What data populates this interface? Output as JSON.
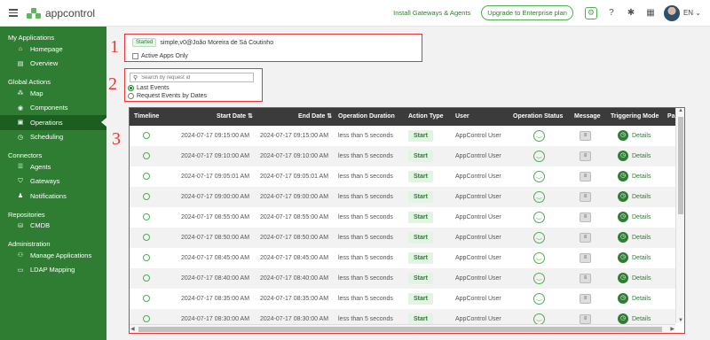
{
  "topbar": {
    "app_name": "appcontrol",
    "install_link": "Install Gateways & Agents",
    "upgrade_button": "Upgrade to Enterprise plan",
    "language": "EN"
  },
  "sidebar": {
    "sections": [
      {
        "title": "My Applications",
        "items": [
          {
            "label": "Homepage",
            "icon": "home-icon"
          },
          {
            "label": "Overview",
            "icon": "overview-icon"
          }
        ]
      },
      {
        "title": "Global Actions",
        "items": [
          {
            "label": "Map",
            "icon": "map-icon"
          },
          {
            "label": "Components",
            "icon": "components-icon"
          },
          {
            "label": "Operations",
            "icon": "operations-icon"
          },
          {
            "label": "Scheduling",
            "icon": "scheduling-icon"
          }
        ]
      },
      {
        "title": "Connectors",
        "items": [
          {
            "label": "Agents",
            "icon": "agents-icon"
          },
          {
            "label": "Gateways",
            "icon": "gateways-icon"
          },
          {
            "label": "Notifications",
            "icon": "notifications-icon"
          }
        ]
      },
      {
        "title": "Repositories",
        "items": [
          {
            "label": "CMDB",
            "icon": "cmdb-icon"
          }
        ]
      },
      {
        "title": "Administration",
        "items": [
          {
            "label": "Manage Applications",
            "icon": "manage-applications-icon"
          },
          {
            "label": "LDAP Mapping",
            "icon": "ldap-icon"
          }
        ]
      }
    ],
    "active": "Operations"
  },
  "annotations": [
    "1",
    "2",
    "3"
  ],
  "app_selector": {
    "status_badge": "Started",
    "app_name": "simple,v0@João Moreira de Sá Coutinho",
    "active_only_label": "Active Apps Only"
  },
  "filters": {
    "search_placeholder": "Search by request id",
    "radio_last": "Last Events",
    "radio_by_dates": "Request Events by Dates"
  },
  "table": {
    "headers": [
      "Timeline",
      "Start Date",
      "End Date",
      "Operation Duration",
      "Action Type",
      "User",
      "Operation Status",
      "Message",
      "Triggering Mode",
      "Pa"
    ],
    "rows": [
      {
        "start": "2024-07-17 09:15:00 AM",
        "end": "2024-07-17 09:15:00 AM",
        "duration": "less than 5 seconds",
        "action": "Start",
        "user": "AppControl User",
        "details": "Details"
      },
      {
        "start": "2024-07-17 09:10:00 AM",
        "end": "2024-07-17 09:10:00 AM",
        "duration": "less than 5 seconds",
        "action": "Start",
        "user": "AppControl User",
        "details": "Details"
      },
      {
        "start": "2024-07-17 09:05:01 AM",
        "end": "2024-07-17 09:05:01 AM",
        "duration": "less than 5 seconds",
        "action": "Start",
        "user": "AppControl User",
        "details": "Details"
      },
      {
        "start": "2024-07-17 09:00:00 AM",
        "end": "2024-07-17 09:00:00 AM",
        "duration": "less than 5 seconds",
        "action": "Start",
        "user": "AppControl User",
        "details": "Details"
      },
      {
        "start": "2024-07-17 08:55:00 AM",
        "end": "2024-07-17 08:55:00 AM",
        "duration": "less than 5 seconds",
        "action": "Start",
        "user": "AppControl User",
        "details": "Details"
      },
      {
        "start": "2024-07-17 08:50:00 AM",
        "end": "2024-07-17 08:50:00 AM",
        "duration": "less than 5 seconds",
        "action": "Start",
        "user": "AppControl User",
        "details": "Details"
      },
      {
        "start": "2024-07-17 08:45:00 AM",
        "end": "2024-07-17 08:45:00 AM",
        "duration": "less than 5 seconds",
        "action": "Start",
        "user": "AppControl User",
        "details": "Details"
      },
      {
        "start": "2024-07-17 08:40:00 AM",
        "end": "2024-07-17 08:40:00 AM",
        "duration": "less than 5 seconds",
        "action": "Start",
        "user": "AppControl User",
        "details": "Details"
      },
      {
        "start": "2024-07-17 08:35:00 AM",
        "end": "2024-07-17 08:35:00 AM",
        "duration": "less than 5 seconds",
        "action": "Start",
        "user": "AppControl User",
        "details": "Details"
      },
      {
        "start": "2024-07-17 08:30:00 AM",
        "end": "2024-07-17 08:30:00 AM",
        "duration": "less than 5 seconds",
        "action": "Start",
        "user": "AppControl User",
        "details": "Details"
      }
    ]
  },
  "colors": {
    "brand": "#2e7d32",
    "annotation": "#ee3333"
  }
}
